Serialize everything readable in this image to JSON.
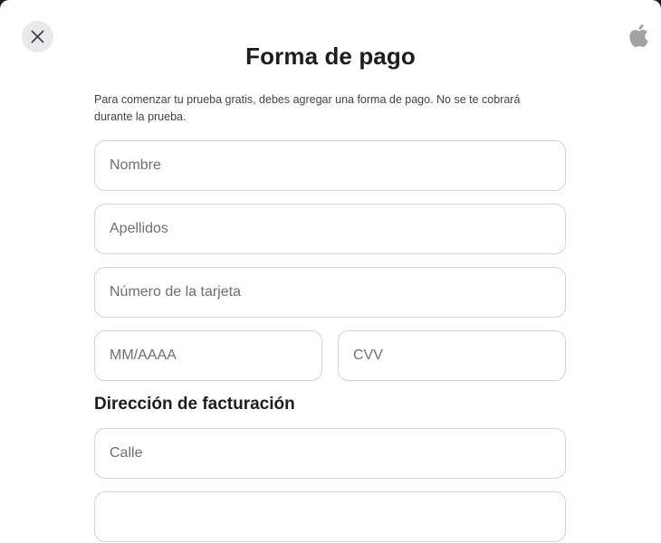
{
  "payment_sheet": {
    "title": "Forma de pago",
    "intro": "Para comenzar tu prueba gratis, debes agregar una forma de pago. No se te cobrará durante la prueba.",
    "fields": {
      "first_name_placeholder": "Nombre",
      "last_name_placeholder": "Apellidos",
      "card_number_placeholder": "Número de la tarjeta",
      "expiry_placeholder": "MM/AAAA",
      "cvv_placeholder": "CVV"
    },
    "billing_section": {
      "heading": "Dirección de facturación",
      "street_placeholder": "Calle"
    }
  },
  "icons": {
    "close": "close-icon",
    "logo": "apple-logo-icon"
  }
}
